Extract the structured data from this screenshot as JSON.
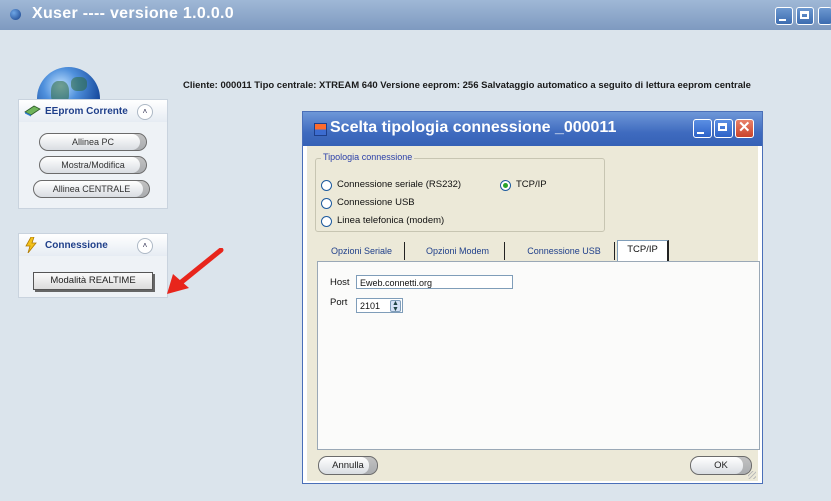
{
  "window": {
    "title": "Xuser  ---- versione 1.0.0.0"
  },
  "info_line": "Cliente: 000011 Tipo centrale: XTREAM 640 Versione eeprom: 256   Salvataggio automatico a seguito di lettura eeprom centrale",
  "sidebar": {
    "eeprom_panel": {
      "title": "EEprom Corrente",
      "buttons": [
        {
          "label": "Allinea PC"
        },
        {
          "label": "Mostra/Modifica"
        },
        {
          "label": "Allinea CENTRALE"
        }
      ]
    },
    "connection_panel": {
      "title": "Connessione",
      "button_label": "Modalità REALTIME"
    }
  },
  "dialog": {
    "title": "Scelta tipologia connessione   _000011",
    "group_legend": "Tipologia connessione",
    "options": [
      {
        "label": "Connessione seriale (RS232)",
        "selected": false
      },
      {
        "label": "Connessione USB",
        "selected": false
      },
      {
        "label": "Linea telefonica (modem)",
        "selected": false
      },
      {
        "label": "TCP/IP",
        "selected": true
      }
    ],
    "tabs": [
      {
        "label": "Opzioni Seriale",
        "active": false
      },
      {
        "label": "Opzioni Modem",
        "active": false
      },
      {
        "label": "Connessione USB",
        "active": false
      },
      {
        "label": "TCP/IP",
        "active": true
      }
    ],
    "host_label": "Host",
    "host_value": "Eweb.connetti.org",
    "port_label": "Port",
    "port_value": "2101",
    "cancel_label": "Annulla",
    "ok_label": "OK"
  },
  "colors": {
    "arrow": "#e8251c",
    "dialog_title_bg": "#3f6bbf",
    "main_title_bg": "#8fa9cc"
  }
}
